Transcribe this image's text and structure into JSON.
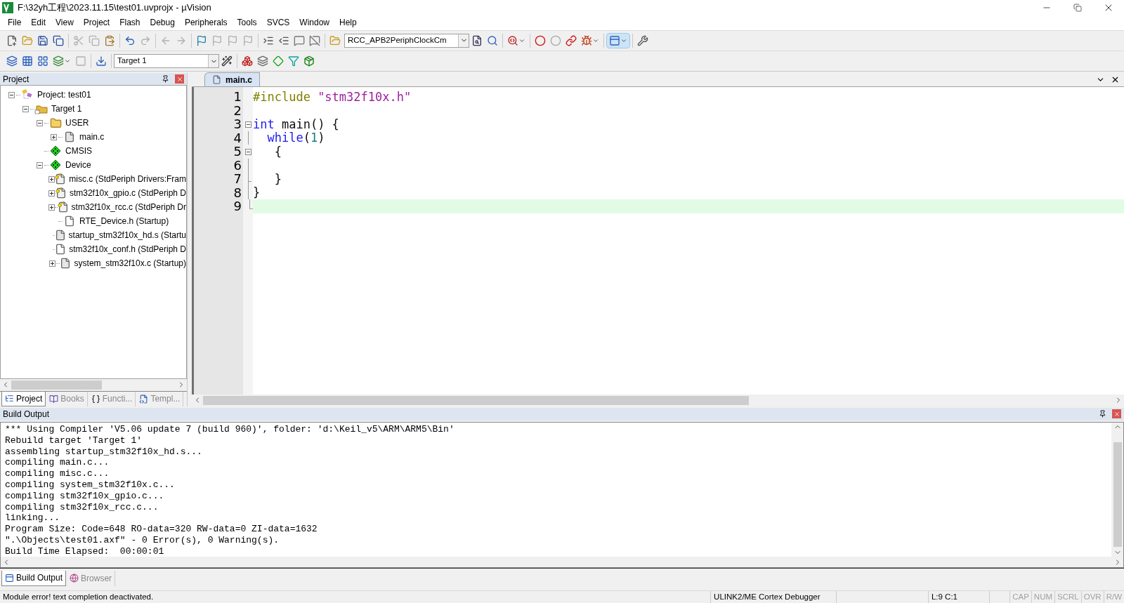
{
  "window": {
    "title": "F:\\32yh工程\\2023.11.15\\test01.uvprojx - µVision"
  },
  "menu": [
    "File",
    "Edit",
    "View",
    "Project",
    "Flash",
    "Debug",
    "Peripherals",
    "Tools",
    "SVCS",
    "Window",
    "Help"
  ],
  "toolbar": {
    "find_combo": "RCC_APB2PeriphClockCm",
    "target_combo": "Target 1"
  },
  "project_panel": {
    "title": "Project",
    "tree": [
      {
        "label": "Project: test01",
        "kind": "project",
        "expanded": true,
        "children": [
          {
            "label": "Target 1",
            "kind": "target",
            "expanded": true,
            "children": [
              {
                "label": "USER",
                "kind": "folder",
                "expanded": true,
                "children": [
                  {
                    "label": "main.c",
                    "kind": "file",
                    "expanded": false
                  }
                ]
              },
              {
                "label": "CMSIS",
                "kind": "component"
              },
              {
                "label": "Device",
                "kind": "component",
                "expanded": true,
                "children": [
                  {
                    "label": "misc.c (StdPeriph Drivers:Fram",
                    "kind": "locked",
                    "expanded": false
                  },
                  {
                    "label": "stm32f10x_gpio.c (StdPeriph D",
                    "kind": "locked",
                    "expanded": false
                  },
                  {
                    "label": "stm32f10x_rcc.c (StdPeriph Dr",
                    "kind": "locked",
                    "expanded": false
                  },
                  {
                    "label": "RTE_Device.h (Startup)",
                    "kind": "header"
                  },
                  {
                    "label": "startup_stm32f10x_hd.s (Startu",
                    "kind": "file"
                  },
                  {
                    "label": "stm32f10x_conf.h (StdPeriph D",
                    "kind": "header"
                  },
                  {
                    "label": "system_stm32f10x.c (Startup)",
                    "kind": "file",
                    "expanded": false
                  }
                ]
              }
            ]
          }
        ]
      }
    ],
    "tabs": [
      {
        "label": "Project",
        "selected": true
      },
      {
        "label": "Books",
        "selected": false
      },
      {
        "label": "Functi...",
        "selected": false
      },
      {
        "label": "Templ...",
        "selected": false
      }
    ]
  },
  "editor": {
    "tabs": [
      {
        "label": "main.c",
        "selected": true
      }
    ],
    "lines": [
      {
        "number": "1",
        "kind": "plain",
        "tokens": [
          {
            "text": "#include ",
            "kind": "preprocessor"
          },
          {
            "text": "\"stm32f10x.h\"",
            "kind": "string"
          }
        ]
      },
      {
        "number": "2",
        "kind": "plain"
      },
      {
        "number": "3",
        "kind": "fold_start",
        "tokens": [
          {
            "text": "int",
            "kind": "keyword"
          },
          {
            "text": " main() {",
            "kind": "plain"
          }
        ]
      },
      {
        "number": "4",
        "kind": "fold_body",
        "tokens": [
          {
            "text": "  while",
            "kind": "keyword"
          },
          {
            "text": "(",
            "kind": "plain"
          },
          {
            "text": "1",
            "kind": "number"
          },
          {
            "text": ")",
            "kind": "plain"
          }
        ]
      },
      {
        "number": "5",
        "kind": "fold_start",
        "tokens": [
          {
            "text": "   {",
            "kind": "plain"
          }
        ]
      },
      {
        "number": "6",
        "kind": "fold_body"
      },
      {
        "number": "7",
        "kind": "fold_tick",
        "tokens": [
          {
            "text": "   }",
            "kind": "plain"
          }
        ]
      },
      {
        "number": "8",
        "kind": "fold_body",
        "tokens": [
          {
            "text": "}",
            "kind": "plain"
          }
        ]
      },
      {
        "number": "9",
        "kind": "fold_end",
        "current": true
      }
    ]
  },
  "build_output": {
    "title": "Build Output",
    "lines": [
      "*** Using Compiler 'V5.06 update 7 (build 960)', folder: 'd:\\Keil_v5\\ARM\\ARM5\\Bin'",
      "Rebuild target 'Target 1'",
      "assembling startup_stm32f10x_hd.s...",
      "compiling main.c...",
      "compiling misc.c...",
      "compiling system_stm32f10x.c...",
      "compiling stm32f10x_gpio.c...",
      "compiling stm32f10x_rcc.c...",
      "linking...",
      "Program Size: Code=648 RO-data=320 RW-data=0 ZI-data=1632",
      "\".\\Objects\\test01.axf\" - 0 Error(s), 0 Warning(s).",
      "Build Time Elapsed:  00:00:01"
    ],
    "tabs": [
      {
        "label": "Build Output",
        "selected": true
      },
      {
        "label": "Browser",
        "selected": false
      }
    ]
  },
  "status_bar": {
    "message": "Module error! text completion deactivated.",
    "debugger": "ULINK2/ME Cortex Debugger",
    "position": "L:9 C:1",
    "indicators": [
      {
        "label": "CAP",
        "active": false
      },
      {
        "label": "NUM",
        "active": false
      },
      {
        "label": "SCRL",
        "active": false
      },
      {
        "label": "OVR",
        "active": false
      },
      {
        "label": "R/W",
        "active": false
      }
    ]
  }
}
